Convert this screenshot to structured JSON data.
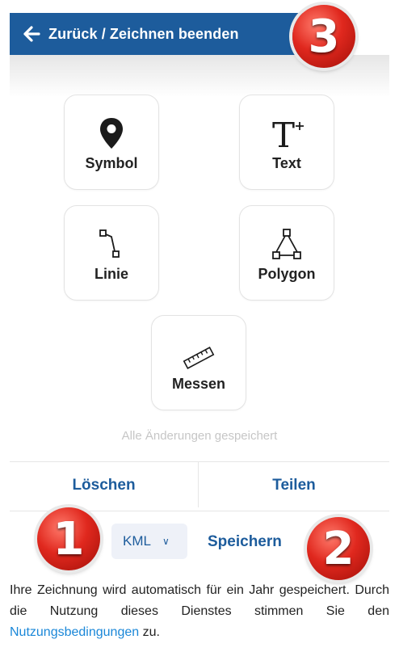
{
  "header": {
    "back_label": "Zurück / Zeichnen beenden"
  },
  "tools": [
    {
      "id": "symbol",
      "label": "Symbol",
      "icon": "map-pin-icon"
    },
    {
      "id": "text",
      "label": "Text",
      "icon": "text-add-icon"
    },
    {
      "id": "linie",
      "label": "Linie",
      "icon": "line-draw-icon"
    },
    {
      "id": "polygon",
      "label": "Polygon",
      "icon": "polygon-draw-icon"
    },
    {
      "id": "messen",
      "label": "Messen",
      "icon": "ruler-icon"
    }
  ],
  "status": "Alle Änderungen gespeichert",
  "actions": {
    "delete": "Löschen",
    "share": "Teilen"
  },
  "export": {
    "format": "KML",
    "save": "Speichern"
  },
  "note": {
    "before_link": "Ihre Zeichnung wird automatisch für ein Jahr gespeichert. Durch die Nutzung dieses Dienstes stimmen Sie den ",
    "link": "Nutzungsbedingungen",
    "after_link": " zu."
  },
  "badges": {
    "one": "1",
    "two": "2",
    "three": "3"
  },
  "colors": {
    "primary": "#1d5c9c",
    "link": "#1a87d8",
    "badge": "#e0281e"
  }
}
